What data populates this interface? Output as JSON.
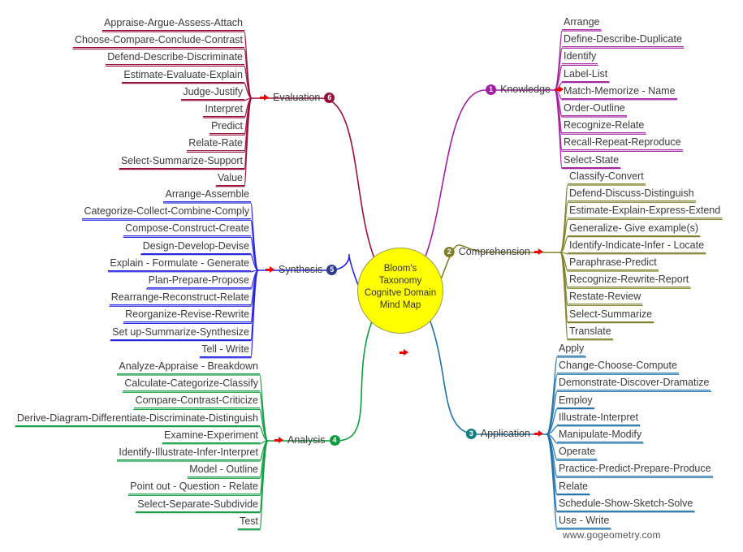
{
  "center": {
    "lines": [
      "Bloom's",
      "Taxonomy",
      "Cognitve Domain",
      "Mind Map"
    ],
    "fill": "#FFFF00",
    "arrow": "right-arrow-icon"
  },
  "footer": {
    "text": "www.gogeometry.com"
  },
  "colors": {
    "knowledge": "#A020A0",
    "comprehension": "#80802B",
    "application": "#1F6FA8",
    "application_badge": "#11807E",
    "analysis": "#109B3E",
    "synthesis": "#2222DD",
    "evaluation": "#97103C",
    "arrow": "#EE0000",
    "text": "#3A3A3A"
  },
  "branches": [
    {
      "id": "knowledge",
      "number": "1",
      "label": "Knowledge",
      "side": "right",
      "color": "#A020A0",
      "badge_color": "#A020A0",
      "items": [
        "Arrange",
        "Define-Describe-Duplicate",
        "Identify",
        "Label-List",
        "Match-Memorize - Name",
        "Order-Outline",
        "Recognize-Relate",
        "Recall-Repeat-Reproduce",
        "Select-State"
      ]
    },
    {
      "id": "comprehension",
      "number": "2",
      "label": "Comprehension",
      "side": "right",
      "color": "#80802B",
      "badge_color": "#80802B",
      "items": [
        "Classify-Convert",
        "Defend-Discuss-Distinguish",
        "Estimate-Explain-Express-Extend",
        "Generalize- Give example(s)",
        "Identify-Indicate-Infer - Locate",
        "Paraphrase-Predict",
        "Recognize-Rewrite-Report",
        "Restate-Review",
        "Select-Summarize",
        "Translate"
      ]
    },
    {
      "id": "application",
      "number": "3",
      "label": "Application",
      "side": "right",
      "color": "#1F6FA8",
      "badge_color": "#11807E",
      "items": [
        "Apply",
        "Change-Choose-Compute",
        "Demonstrate-Discover-Dramatize",
        "Employ",
        "Illustrate-Interpret",
        "Manipulate-Modify",
        "Operate",
        "Practice-Predict-Prepare-Produce",
        "Relate",
        "Schedule-Show-Sketch-Solve",
        "Use - Write"
      ]
    },
    {
      "id": "analysis",
      "number": "4",
      "label": "Analysis",
      "side": "left",
      "color": "#109B3E",
      "badge_color": "#109B3E",
      "items": [
        "Analyze-Appraise - Breakdown",
        "Calculate-Categorize-Classify",
        "Compare-Contrast-Criticize",
        "Derive-Diagram-Differentiate-Discriminate-Distinguish",
        "Examine-Experiment",
        "Identify-Illustrate-Infer-Interpret",
        "Model - Outline",
        "Point out - Question - Relate",
        "Select-Separate-Subdivide",
        "Test"
      ]
    },
    {
      "id": "synthesis",
      "number": "5",
      "label": "Synthesis",
      "side": "left",
      "color": "#2222DD",
      "badge_color": "#2D3A8C",
      "items": [
        "Arrange-Assemble",
        "Categorize-Collect-Combine-Comply",
        "Compose-Construct-Create",
        "Design-Develop-Devise",
        "Explain - Formulate - Generate",
        "Plan-Prepare-Propose",
        "Rearrange-Reconstruct-Relate",
        "Reorganize-Revise-Rewrite",
        "Set up-Summarize-Synthesize",
        "Tell - Write"
      ]
    },
    {
      "id": "evaluation",
      "number": "6",
      "label": "Evaluation",
      "side": "left",
      "color": "#97103C",
      "badge_color": "#97103C",
      "items": [
        "Appraise-Argue-Assess-Attach",
        "Choose-Compare-Conclude-Contrast",
        "Defend-Describe-Discriminate",
        "Estimate-Evaluate-Explain",
        "Judge-Justify",
        "Interpret",
        "Predict",
        "Relate-Rate",
        "Select-Summarize-Support",
        "Value"
      ]
    }
  ]
}
